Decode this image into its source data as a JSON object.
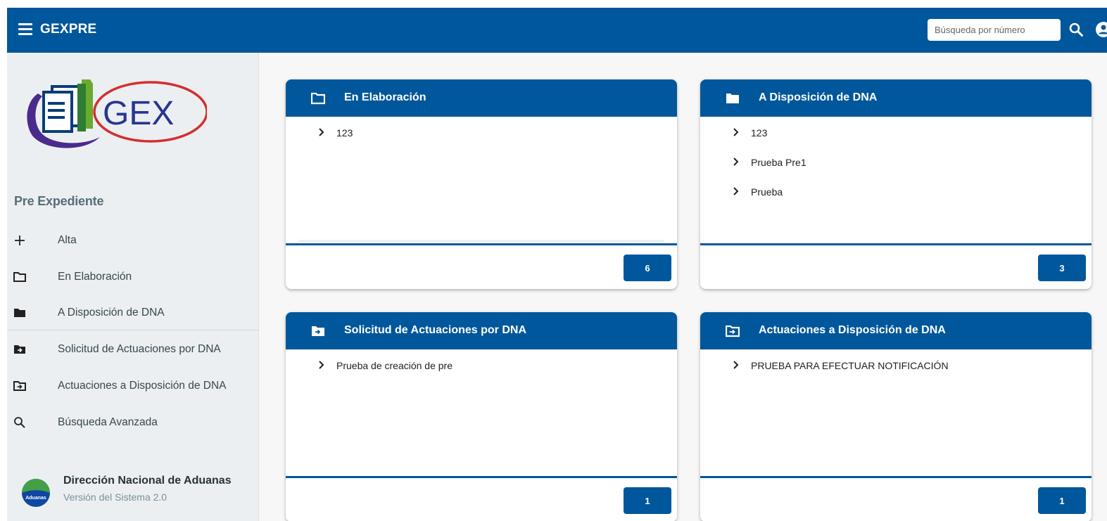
{
  "header": {
    "title": "GEXPRE",
    "search_placeholder": "Búsqueda por número"
  },
  "sidebar": {
    "logo_text": "GEX",
    "section_title": "Pre Expediente",
    "items": [
      {
        "label": "Alta",
        "icon": "plus-icon"
      },
      {
        "label": "En Elaboración",
        "icon": "folder-outline-icon"
      },
      {
        "label": "A Disposición de DNA",
        "icon": "folder-filled-icon"
      },
      {
        "label": "Solicitud de Actuaciones por DNA",
        "icon": "folder-arrow-filled-icon"
      },
      {
        "label": "Actuaciones a Disposición de DNA",
        "icon": "folder-arrow-outline-icon"
      },
      {
        "label": "Búsqueda Avanzada",
        "icon": "search-icon"
      }
    ],
    "org_name": "Dirección Nacional de Aduanas",
    "org_version": "Versión del Sistema 2.0",
    "org_logo_text": "Aduanas"
  },
  "cards": [
    {
      "title": "En Elaboración",
      "icon": "folder-outline-icon",
      "items": [
        "123"
      ],
      "count": "6"
    },
    {
      "title": "A Disposición de DNA",
      "icon": "folder-filled-icon",
      "items": [
        "123",
        "Prueba Pre1",
        "Prueba"
      ],
      "count": "3"
    },
    {
      "title": "Solicitud de Actuaciones por DNA",
      "icon": "folder-arrow-filled-icon",
      "items": [
        "Prueba de creación de pre"
      ],
      "count": "1"
    },
    {
      "title": "Actuaciones a Disposición de DNA",
      "icon": "folder-arrow-outline-icon",
      "items": [
        "PRUEBA PARA EFECTUAR NOTIFICACIÓN"
      ],
      "count": "1"
    }
  ],
  "colors": {
    "primary": "#01579b",
    "sidebar_bg": "#eceff1",
    "section_title": "#546e7a"
  }
}
